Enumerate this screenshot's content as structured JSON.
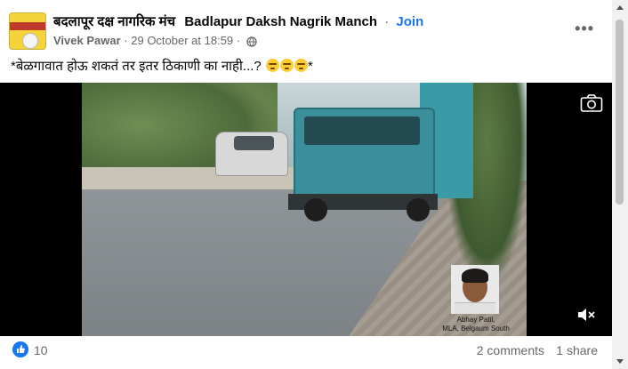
{
  "post": {
    "group_name_marathi": "बदलापूर दक्ष नागरिक मंच",
    "group_name_english": "Badlapur Daksh Nagrik Manch",
    "separator": "·",
    "join_label": "Join",
    "author": "Vivek Pawar",
    "timestamp": "29 October at 18:59",
    "meta_separator": "·",
    "privacy_icon": "globe-icon",
    "more_icon": "more-options-icon",
    "more_label": "•••",
    "text": "*बेळगावात होऊ शकतं तर इतर ठिकाणी का नाही...? ",
    "text_end": "*",
    "emoji_count": 3,
    "emoji_icon": "thinking-face-emoji"
  },
  "video": {
    "camera_icon": "camera-icon",
    "mute_icon": "speaker-muted-icon",
    "caption_line1": "Abhay Patil,",
    "caption_line2": "MLA, Belgaum South"
  },
  "footer": {
    "like_icon": "like-thumb-icon",
    "like_count": "10",
    "comments": "2 comments",
    "shares": "1 share"
  },
  "colors": {
    "accent": "#1877f2",
    "secondary_text": "#65676b",
    "truck": "#3a8f9a"
  }
}
